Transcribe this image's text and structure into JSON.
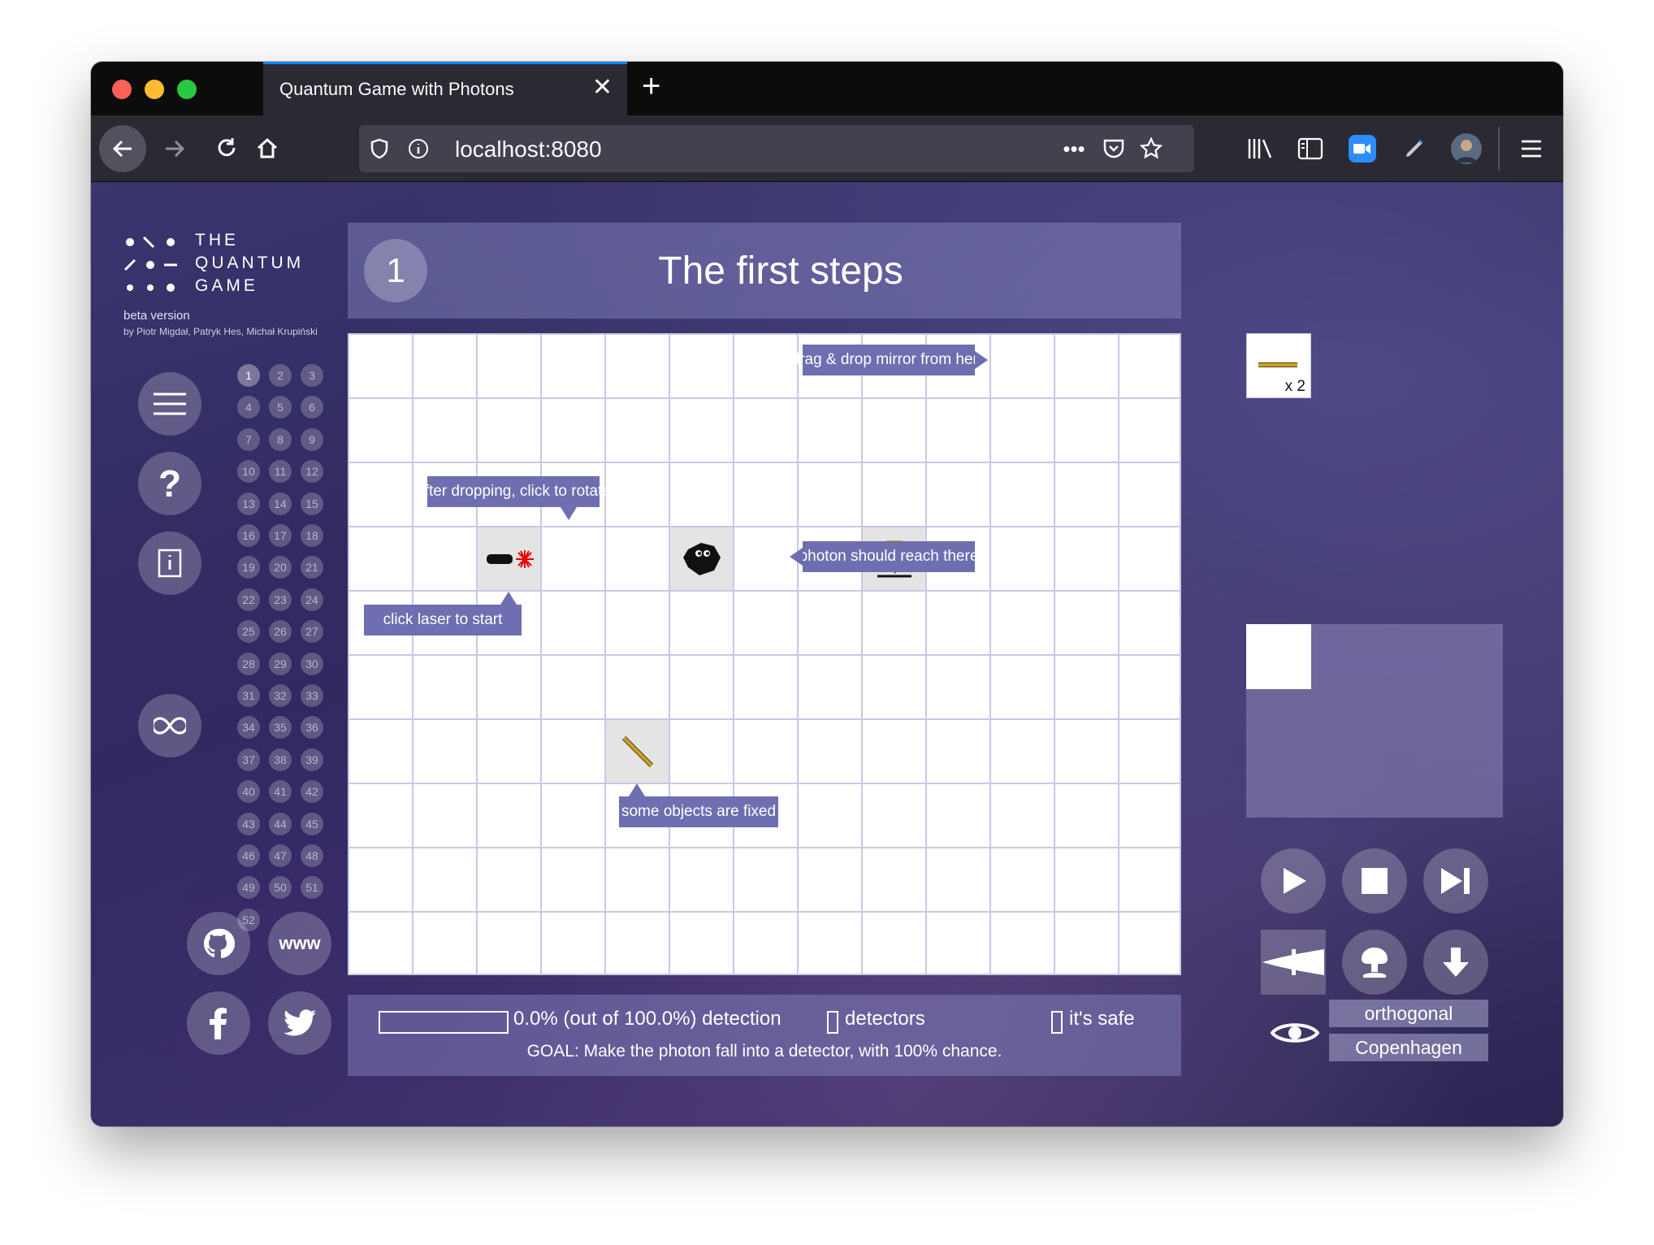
{
  "browser": {
    "tab_title": "Quantum Game with Photons",
    "url": "localhost:8080"
  },
  "logo": {
    "line1": "THE",
    "line2": "QUANTUM",
    "line3": "GAME",
    "beta": "beta version",
    "authors": "by Piotr Migdał, Patryk Hes, Michał Krupiński"
  },
  "sidebar": {
    "levels": [
      "1",
      "2",
      "3",
      "4",
      "5",
      "6",
      "7",
      "8",
      "9",
      "10",
      "11",
      "12",
      "13",
      "14",
      "15",
      "16",
      "17",
      "18",
      "19",
      "20",
      "21",
      "22",
      "23",
      "24",
      "25",
      "26",
      "27",
      "28",
      "29",
      "30",
      "31",
      "32",
      "33",
      "34",
      "35",
      "36",
      "37",
      "38",
      "39",
      "40",
      "41",
      "42",
      "43",
      "44",
      "45",
      "46",
      "47",
      "48",
      "49",
      "50",
      "51",
      "52"
    ],
    "active_level": "1",
    "help_label": "?",
    "www_label": "www"
  },
  "level": {
    "number": "1",
    "title": "The first steps"
  },
  "tips": {
    "drag_drop": "drag & drop mirror from here",
    "rotate": "after dropping, click to rotate",
    "photon_reach": "photon should reach there",
    "click_laser": "click laser to start",
    "fixed": "some objects are fixed"
  },
  "toolbox": {
    "mirror_count": "x 2"
  },
  "status": {
    "detection": "0.0% (out of 100.0%) detection",
    "detection_fraction": 0.0,
    "detectors": "detectors",
    "safe": "it's safe",
    "goal": "GOAL: Make the photon fall into a detector, with 100% chance."
  },
  "modes": {
    "basis": "orthogonal",
    "interpretation": "Copenhagen"
  },
  "colors": {
    "tip_bg": "#6e6eb0",
    "accent_tab": "#0a84ff",
    "mirror": "#c9a227"
  }
}
